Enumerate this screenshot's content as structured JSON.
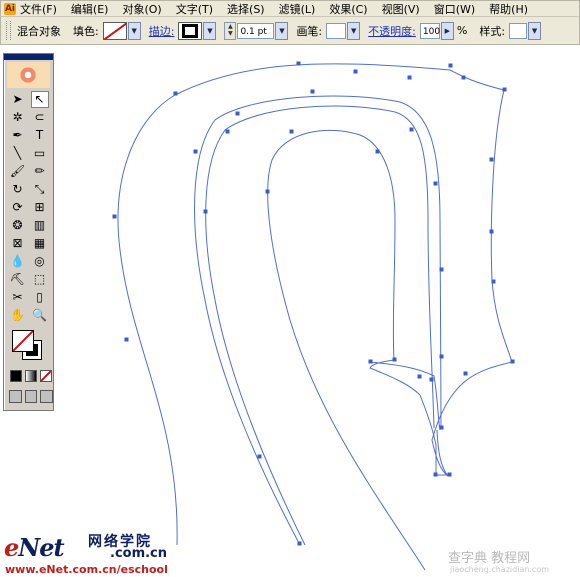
{
  "menubar": {
    "app_icon": "Ai",
    "items": [
      "文件(F)",
      "编辑(E)",
      "对象(O)",
      "文字(T)",
      "选择(S)",
      "滤镜(L)",
      "效果(C)",
      "视图(V)",
      "窗口(W)",
      "帮助(H)"
    ]
  },
  "controlbar": {
    "selection_label": "混合对象",
    "fill_label": "填色:",
    "stroke_label": "描边:",
    "stroke_weight": "0.1 pt",
    "brush_label": "画笔:",
    "opacity_label": "不透明度:",
    "opacity_value": "100",
    "opacity_unit": "%",
    "style_label": "样式:"
  },
  "toolbox": {
    "tool_icons": [
      "selection-arrow-icon",
      "direct-selection-icon",
      "magic-wand-icon",
      "lasso-icon",
      "pen-icon",
      "type-icon",
      "line-segment-icon",
      "rectangle-icon",
      "paintbrush-icon",
      "pencil-icon",
      "rotate-icon",
      "scale-icon",
      "warp-icon",
      "free-transform-icon",
      "symbol-sprayer-icon",
      "column-graph-icon",
      "mesh-icon",
      "gradient-icon",
      "eyedropper-icon",
      "blend-icon",
      "live-paint-bucket-icon",
      "live-paint-selection-icon",
      "slice-icon",
      "eraser-icon",
      "hand-icon",
      "zoom-icon"
    ],
    "tool_glyphs": [
      "➤",
      "↖",
      "✲",
      "⊂",
      "✒",
      "T",
      "╲",
      "▭",
      "🖌",
      "✏",
      "↻",
      "⤡",
      "⟳",
      "⊞",
      "❂",
      "▥",
      "⊠",
      "▦",
      "💧",
      "◎",
      "⛏",
      "⬚",
      "✂",
      "▯",
      "✋",
      "🔍"
    ]
  },
  "watermark": {
    "logo": "eNet",
    "logo_e": "e",
    "logo_rest": "Net",
    "cn_name": "网络学院",
    "domain": ".com.cn",
    "url": "www.eNet.com.cn/eschool",
    "site2": "查字典 教程网",
    "site2_url": "jiaocheng.chazidian.com"
  },
  "colors": {
    "path_stroke": "#4f6fce",
    "anchor": "#3a5ec8",
    "ui_face": "#ece9d8",
    "watermark_blue": "#0d1f5f",
    "watermark_red": "#c21d1d"
  }
}
